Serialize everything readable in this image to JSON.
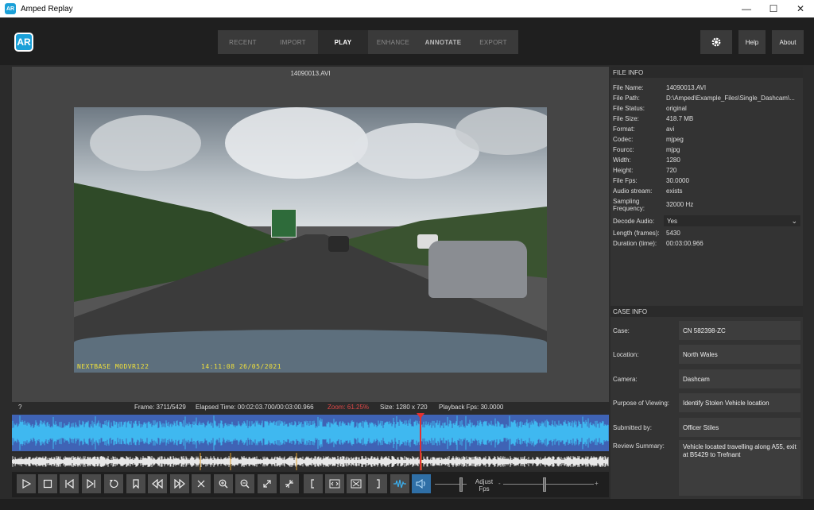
{
  "window": {
    "title": "Amped Replay",
    "app_icon": "AR",
    "controls": [
      "—",
      "☐",
      "✕"
    ]
  },
  "header": {
    "logo": "AR",
    "tabs": [
      {
        "label": "RECENT"
      },
      {
        "label": "IMPORT"
      },
      {
        "label": "PLAY"
      },
      {
        "label": "ENHANCE"
      },
      {
        "label": "ANNOTATE"
      },
      {
        "label": "EXPORT"
      }
    ],
    "active_tab": "PLAY",
    "settings_icon": "gear-icon",
    "help_label": "Help",
    "about_label": "About"
  },
  "player": {
    "filename": "14090013.AVI",
    "overlay_left": "NEXTBASE   MODVR122",
    "overlay_time": "14:11:08 26/05/2021"
  },
  "status": {
    "help": "?",
    "frame": "Frame: 3711/5429",
    "elapsed": "Elapsed Time: 00:02:03.700/00:03:00.966",
    "zoom": "Zoom: 61.25%",
    "size": "Size: 1280 x 720",
    "fps": "Playback Fps: 30.0000"
  },
  "controls": {
    "buttons": [
      "play",
      "stop",
      "prev-frame",
      "next-frame",
      "loop",
      "bookmark",
      "rewind",
      "fast-forward",
      "close",
      "zoom-in",
      "zoom-out",
      "fit",
      "actual-size",
      "mark-in",
      "loop-range",
      "clear-range",
      "mark-out",
      "waveform",
      "volume"
    ],
    "fps_label_1": "Adjust",
    "fps_label_2": "Fps",
    "minus": "-",
    "plus": "+"
  },
  "file_info": {
    "heading": "FILE INFO",
    "rows": [
      {
        "k": "File Name:",
        "v": "14090013.AVI"
      },
      {
        "k": "File Path:",
        "v": "D:\\Amped\\Example_Files\\Single_Dashcam\\..."
      },
      {
        "k": "File Status:",
        "v": "original"
      },
      {
        "k": "File Size:",
        "v": "418.7 MB"
      },
      {
        "k": "Format:",
        "v": "avi"
      },
      {
        "k": "Codec:",
        "v": "mjpeg"
      },
      {
        "k": "Fourcc:",
        "v": "mjpg"
      },
      {
        "k": "Width:",
        "v": "1280"
      },
      {
        "k": "Height:",
        "v": "720"
      },
      {
        "k": "File Fps:",
        "v": "30.0000"
      },
      {
        "k": "Audio stream:",
        "v": "exists"
      },
      {
        "k": "Sampling Frequency:",
        "v": "32000 Hz"
      }
    ],
    "decode_label": "Decode Audio:",
    "decode_value": "Yes",
    "rows2": [
      {
        "k": "Length (frames):",
        "v": "5430"
      },
      {
        "k": "Duration (time):",
        "v": "00:03:00.966"
      }
    ]
  },
  "case_info": {
    "heading": "CASE INFO",
    "case_label": "Case:",
    "case_value": "CN 582398-ZC",
    "location_label": "Location:",
    "location_value": "North Wales",
    "camera_label": "Camera:",
    "camera_value": "Dashcam",
    "purpose_label": "Purpose of Viewing:",
    "purpose_value": "Identify Stolen Vehicle location",
    "submitted_label": "Submitted by:",
    "submitted_value": "Officer Stiles",
    "review_label": "Review Summary:",
    "review_value": "Vehicle located travelling along A55, exit at B5429 to Trefnant"
  }
}
